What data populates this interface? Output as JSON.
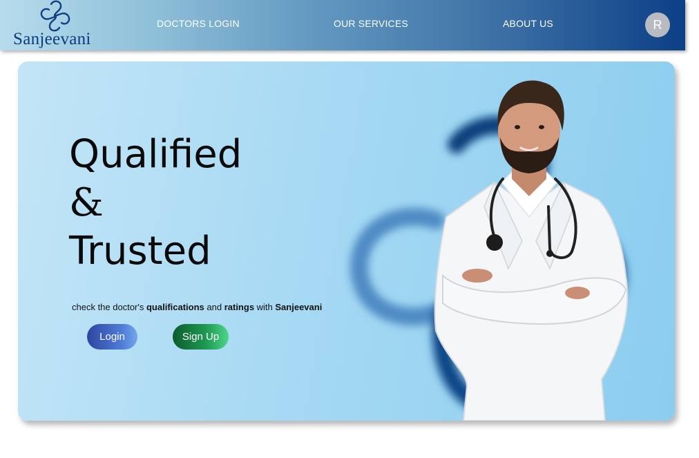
{
  "brand": {
    "name": "Sanjeevani"
  },
  "nav": {
    "doctors_login": "DOCTORS LOGIN",
    "our_services": "OUR SERVICES",
    "about_us": "ABOUT US"
  },
  "user": {
    "initial": "R"
  },
  "hero": {
    "line1": "Qualified",
    "line2": "&",
    "line3": "Trusted",
    "tagline": {
      "t1": "check the doctor's ",
      "b1": "qualifications",
      "t2": " and ",
      "b2": "ratings",
      "t3": " with ",
      "b3": "Sanjeevani"
    },
    "login_label": "Login",
    "signup_label": "Sign Up"
  },
  "icons": {
    "logo": "sanjeevani-logo-icon",
    "background": "cross-shape-icon",
    "doctor": "doctor-illustration"
  },
  "colors": {
    "nav_dark": "#0c3f86",
    "nav_light": "#b7dcec",
    "login": "#3e5fc0",
    "signup": "#1f9a52"
  }
}
